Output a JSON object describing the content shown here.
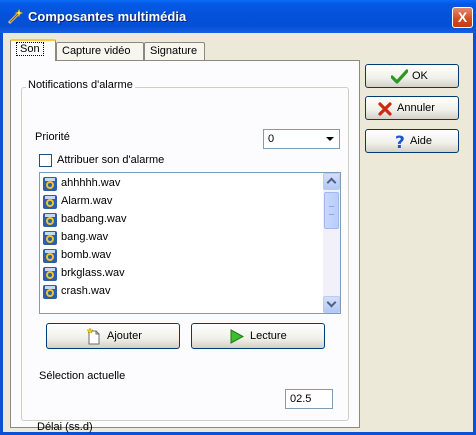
{
  "window": {
    "title": "Composantes multimédia",
    "close_label": "X"
  },
  "tabs": [
    {
      "label": "Son",
      "active": true
    },
    {
      "label": "Capture vidéo",
      "active": false
    },
    {
      "label": "Signature",
      "active": false
    }
  ],
  "alarm_group": {
    "title": "Notifications d'alarme",
    "priority_label": "Priorité",
    "priority_value": "0",
    "assign_sound_label": "Attribuer son d'alarme",
    "assign_sound_checked": false,
    "sound_files": [
      "ahhhhh.wav",
      "Alarm.wav",
      "badbang.wav",
      "bang.wav",
      "bomb.wav",
      "brkglass.wav",
      "crash.wav"
    ],
    "add_button": "Ajouter",
    "play_button": "Lecture",
    "current_selection_label": "Sélection actuelle",
    "delay_label": "Délai (ss.d)",
    "delay_value": "02.5"
  },
  "actions": {
    "ok_label": "OK",
    "cancel_label": "Annuler",
    "help_label": "Aide"
  }
}
